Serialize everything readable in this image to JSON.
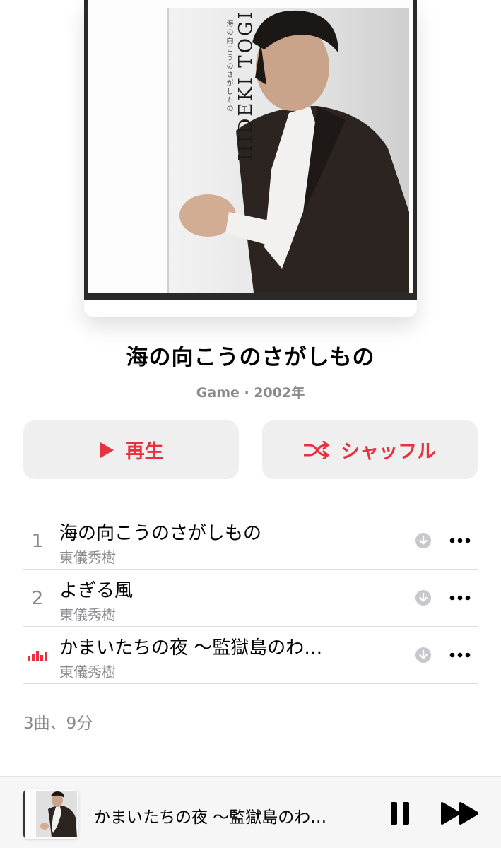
{
  "album": {
    "title": "海の向こうのさがしもの",
    "meta": "Game · 2002年",
    "artwork_text": "HIDEKI TOGI",
    "artwork_subtext": "海の向こうのさがしもの"
  },
  "buttons": {
    "play_label": "再生",
    "shuffle_label": "シャッフル"
  },
  "tracks": [
    {
      "number": "1",
      "title": "海の向こうのさがしもの",
      "artist": "東儀秀樹",
      "playing": false
    },
    {
      "number": "2",
      "title": "よぎる風",
      "artist": "東儀秀樹",
      "playing": false
    },
    {
      "number": "",
      "title": "かまいたちの夜 〜監獄島のわ…",
      "artist": "東儀秀樹",
      "playing": true
    }
  ],
  "summary": "3曲、9分",
  "mini_player": {
    "title": "かまいたちの夜 〜監獄島のわ…"
  },
  "colors": {
    "accent": "#e8313f",
    "secondary_text": "#8a8a8e",
    "button_bg": "#efeff0"
  },
  "icons": {
    "play": "play-icon",
    "shuffle": "shuffle-icon",
    "download": "download-icon",
    "more": "more-icon",
    "now_playing": "now-playing-icon",
    "pause": "pause-icon",
    "forward": "forward-icon"
  }
}
